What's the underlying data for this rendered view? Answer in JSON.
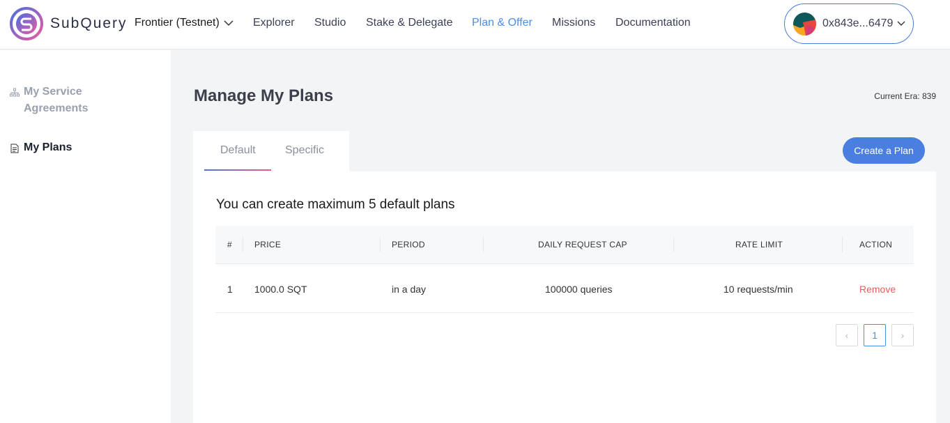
{
  "header": {
    "brand": "SubQuery",
    "network": "Frontier (Testnet)",
    "nav": [
      "Explorer",
      "Studio",
      "Stake & Delegate",
      "Plan & Offer",
      "Missions",
      "Documentation"
    ],
    "active_nav": "Plan & Offer",
    "wallet_address": "0x843e...6479"
  },
  "sidebar": {
    "items": [
      {
        "label": "My Service Agreements",
        "icon": "hierarchy-icon",
        "active": false
      },
      {
        "label": "My Plans",
        "icon": "document-icon",
        "active": true
      }
    ]
  },
  "main": {
    "title": "Manage My Plans",
    "current_era": "Current Era: 839",
    "tabs": [
      {
        "label": "Default",
        "active": true
      },
      {
        "label": "Specific",
        "active": false
      }
    ],
    "create_button": "Create a Plan",
    "subtitle": "You can create maximum 5 default plans",
    "table": {
      "columns": [
        "#",
        "PRICE",
        "PERIOD",
        "DAILY REQUEST CAP",
        "RATE LIMIT",
        "ACTION"
      ],
      "rows": [
        {
          "index": "1",
          "price": "1000.0 SQT",
          "period": "in a day",
          "cap": "100000 queries",
          "rate": "10 requests/min",
          "action": "Remove"
        }
      ]
    },
    "pagination": {
      "current": "1",
      "prev": "‹",
      "next": "›"
    }
  },
  "colors": {
    "accent": "#4a8ee8",
    "button": "#4a7fdf",
    "danger": "#e85a5a"
  }
}
